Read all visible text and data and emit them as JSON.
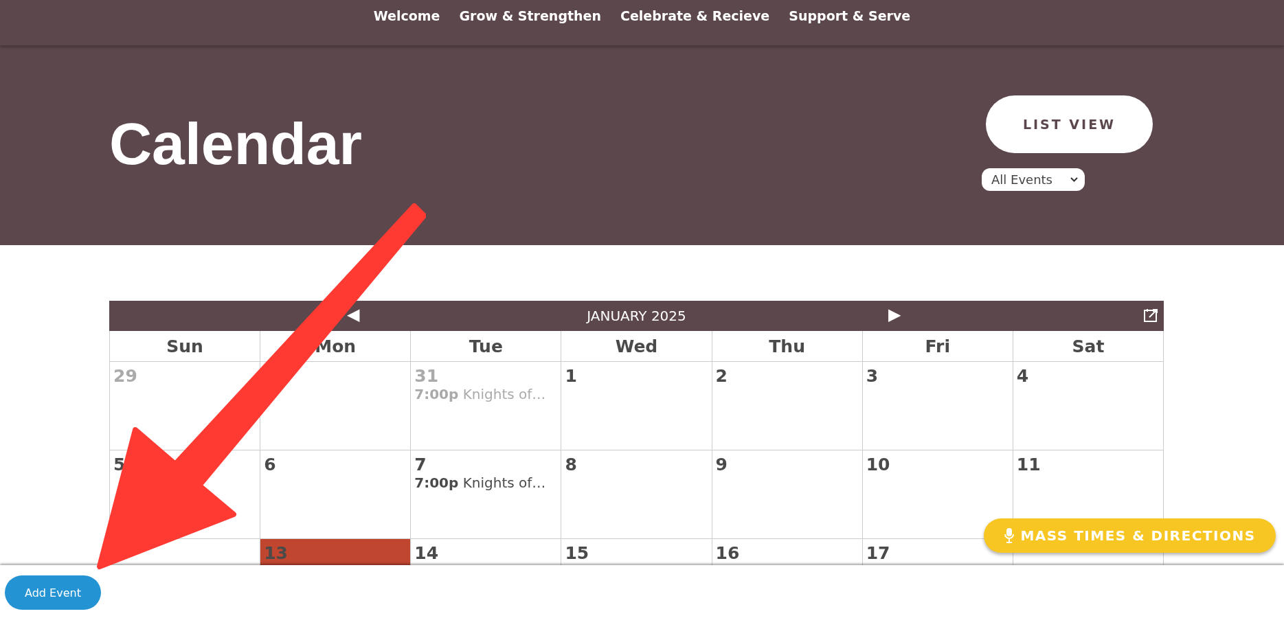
{
  "nav": [
    "Welcome",
    "Grow & Strengthen",
    "Celebrate & Recieve",
    "Support & Serve"
  ],
  "header": {
    "title": "Calendar",
    "list_view_button": "LIST VIEW",
    "filter": {
      "value": "All Events"
    }
  },
  "calendar": {
    "month": "JANUARY 2025",
    "prev": "◀",
    "next": "▶",
    "weekdays": [
      "Sun",
      "Mon",
      "Tue",
      "Wed",
      "Thu",
      "Fri",
      "Sat"
    ],
    "weeks": [
      [
        {
          "day": "29",
          "muted": true,
          "today": false
        },
        {
          "today": false
        },
        {
          "day": "31",
          "muted": true,
          "today": false,
          "events": [
            "**7:00p** Knights of…"
          ]
        },
        {
          "day": "1",
          "muted": false,
          "today": false
        },
        {
          "day": "2",
          "muted": false,
          "today": false
        },
        {
          "day": "3",
          "muted": false,
          "today": false
        },
        {
          "day": "4",
          "muted": false,
          "today": false
        }
      ],
      [
        {
          "day": "5",
          "muted": false,
          "today": false
        },
        {
          "day": "6",
          "muted": false,
          "today": false
        },
        {
          "day": "7",
          "muted": false,
          "today": false,
          "events": [
            "**7:00p** Knights of…"
          ]
        },
        {
          "day": "8",
          "muted": false,
          "today": false
        },
        {
          "day": "9",
          "muted": false,
          "today": false
        },
        {
          "day": "10",
          "muted": false,
          "today": false
        },
        {
          "day": "11",
          "muted": false,
          "today": false
        }
      ],
      [
        {
          "today": false
        },
        {
          "day": "13",
          "muted": false,
          "today": true
        },
        {
          "day": "14",
          "muted": false,
          "today": false
        },
        {
          "day": "15",
          "muted": false,
          "today": false
        },
        {
          "day": "16",
          "muted": false,
          "today": false
        },
        {
          "day": "17",
          "muted": false,
          "today": false
        },
        {
          "today": false
        }
      ]
    ]
  },
  "mass_times_button": "MASS TIMES & DIRECTIONS",
  "add_event_button": "Add Event"
}
